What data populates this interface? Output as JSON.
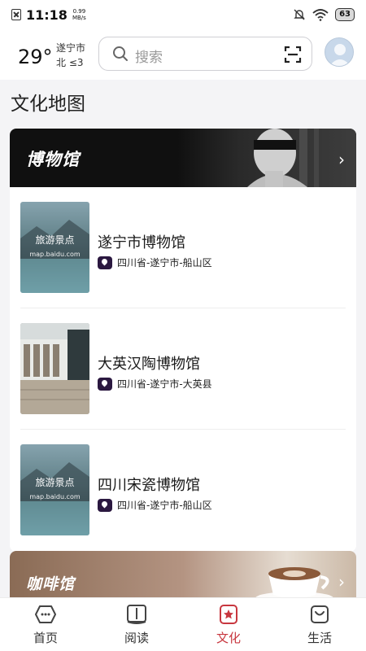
{
  "status_bar": {
    "time": "11:18",
    "net_speed_value": "0.99",
    "net_speed_unit": "MB/s",
    "battery": "63"
  },
  "header": {
    "temperature": "29°",
    "city": "遂宁市",
    "wind": "北 ≤3",
    "search_placeholder": "搜索"
  },
  "page_title": "文化地图",
  "section": {
    "banner_label": "博物馆",
    "items": [
      {
        "name": "遂宁市博物馆",
        "address": "四川省-遂宁市-船山区",
        "thumb_text": "旅游景点",
        "thumb_sub": "map.baidu.com"
      },
      {
        "name": "大英汉陶博物馆",
        "address": "四川省-遂宁市-大英县",
        "thumb_text": "",
        "thumb_sub": ""
      },
      {
        "name": "四川宋瓷博物馆",
        "address": "四川省-遂宁市-船山区",
        "thumb_text": "旅游景点",
        "thumb_sub": "map.baidu.com"
      }
    ]
  },
  "section2": {
    "banner_label": "咖啡馆"
  },
  "tabs": [
    {
      "label": "首页",
      "icon": "home-icon"
    },
    {
      "label": "阅读",
      "icon": "book-icon"
    },
    {
      "label": "文化",
      "icon": "culture-icon",
      "active": true
    },
    {
      "label": "生活",
      "icon": "bag-icon"
    }
  ],
  "colors": {
    "accent": "#c8373f",
    "pin": "#2b1840"
  }
}
